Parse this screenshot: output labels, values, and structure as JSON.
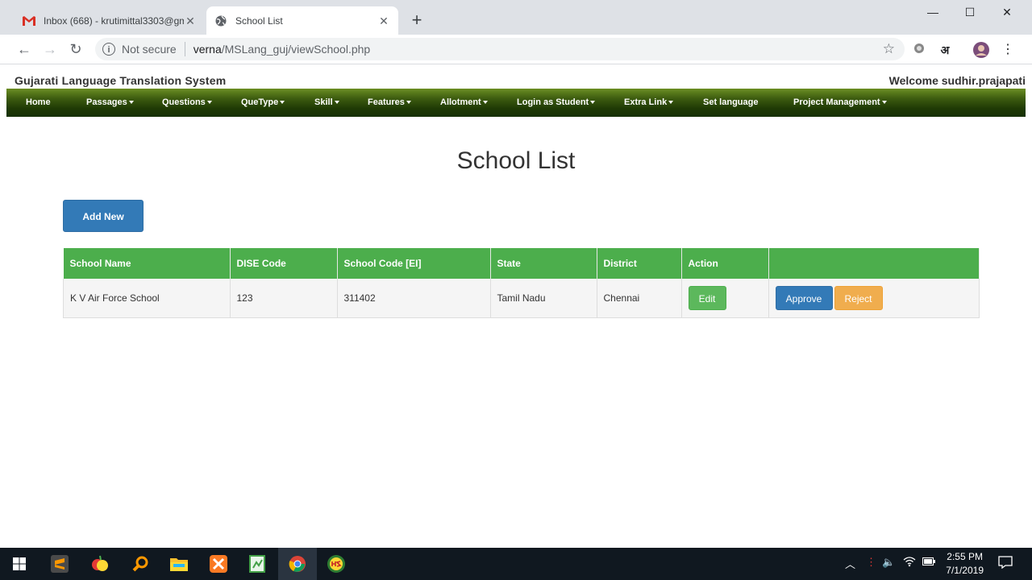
{
  "browser": {
    "tabs": [
      {
        "label": "Inbox (668) - krutimittal3303@gm",
        "active": false
      },
      {
        "label": "School List",
        "active": true
      }
    ],
    "security_label": "Not secure",
    "url_host": "verna",
    "url_path": "/MSLang_guj/viewSchool.php",
    "extension_label": "अ"
  },
  "site": {
    "title": "Gujarati Language Translation System",
    "welcome": "Welcome sudhir.prajapati"
  },
  "menu": [
    {
      "label": "Home",
      "dropdown": false
    },
    {
      "label": "Passages",
      "dropdown": true
    },
    {
      "label": "Questions",
      "dropdown": true
    },
    {
      "label": "QueType",
      "dropdown": true
    },
    {
      "label": "Skill",
      "dropdown": true
    },
    {
      "label": "Features",
      "dropdown": true
    },
    {
      "label": "Allotment",
      "dropdown": true
    },
    {
      "label": "Login as Student",
      "dropdown": true
    },
    {
      "label": "Extra Link",
      "dropdown": true
    },
    {
      "label": "Set language",
      "dropdown": false
    },
    {
      "label": "Project Management",
      "dropdown": true
    }
  ],
  "main": {
    "heading": "School List",
    "add_button": "Add New",
    "table": {
      "columns": [
        "School Name",
        "DISE Code",
        "School Code [EI]",
        "State",
        "District",
        "Action",
        ""
      ],
      "rows": [
        {
          "school_name": "K V Air Force School",
          "dise_code": "123",
          "school_code": "311402",
          "state": "Tamil Nadu",
          "district": "Chennai",
          "edit_label": "Edit",
          "approve_label": "Approve",
          "reject_label": "Reject"
        }
      ]
    }
  },
  "taskbar": {
    "time": "2:55 PM",
    "date": "7/1/2019"
  },
  "colors": {
    "menubar_top": "#6b8e23",
    "menubar_bottom": "#163005",
    "table_header": "#4cae4c",
    "primary": "#337ab7",
    "success": "#5cb85c",
    "warning": "#f0ad4e"
  }
}
